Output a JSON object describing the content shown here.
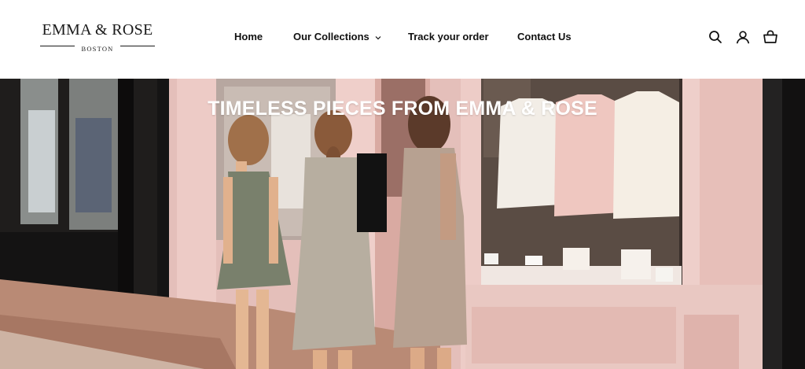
{
  "brand": {
    "name": "EMMA & ROSE",
    "location": "BOSTON"
  },
  "nav": {
    "items": [
      {
        "label": "Home"
      },
      {
        "label": "Our Collections",
        "has_dropdown": true
      },
      {
        "label": "Track your order"
      },
      {
        "label": "Contact Us"
      }
    ]
  },
  "header_icons": [
    "search-icon",
    "account-icon",
    "cart-icon"
  ],
  "hero": {
    "title": "TIMELESS PIECES FROM EMMA & ROSE",
    "image": "three-women-looking-at-boutique-window"
  },
  "colors": {
    "header_bg": "#ffffff",
    "text": "#111111",
    "storefront_pink": "#e9c6c1",
    "storefront_dark": "#1e1e1e",
    "hero_title": "#ffffff"
  }
}
